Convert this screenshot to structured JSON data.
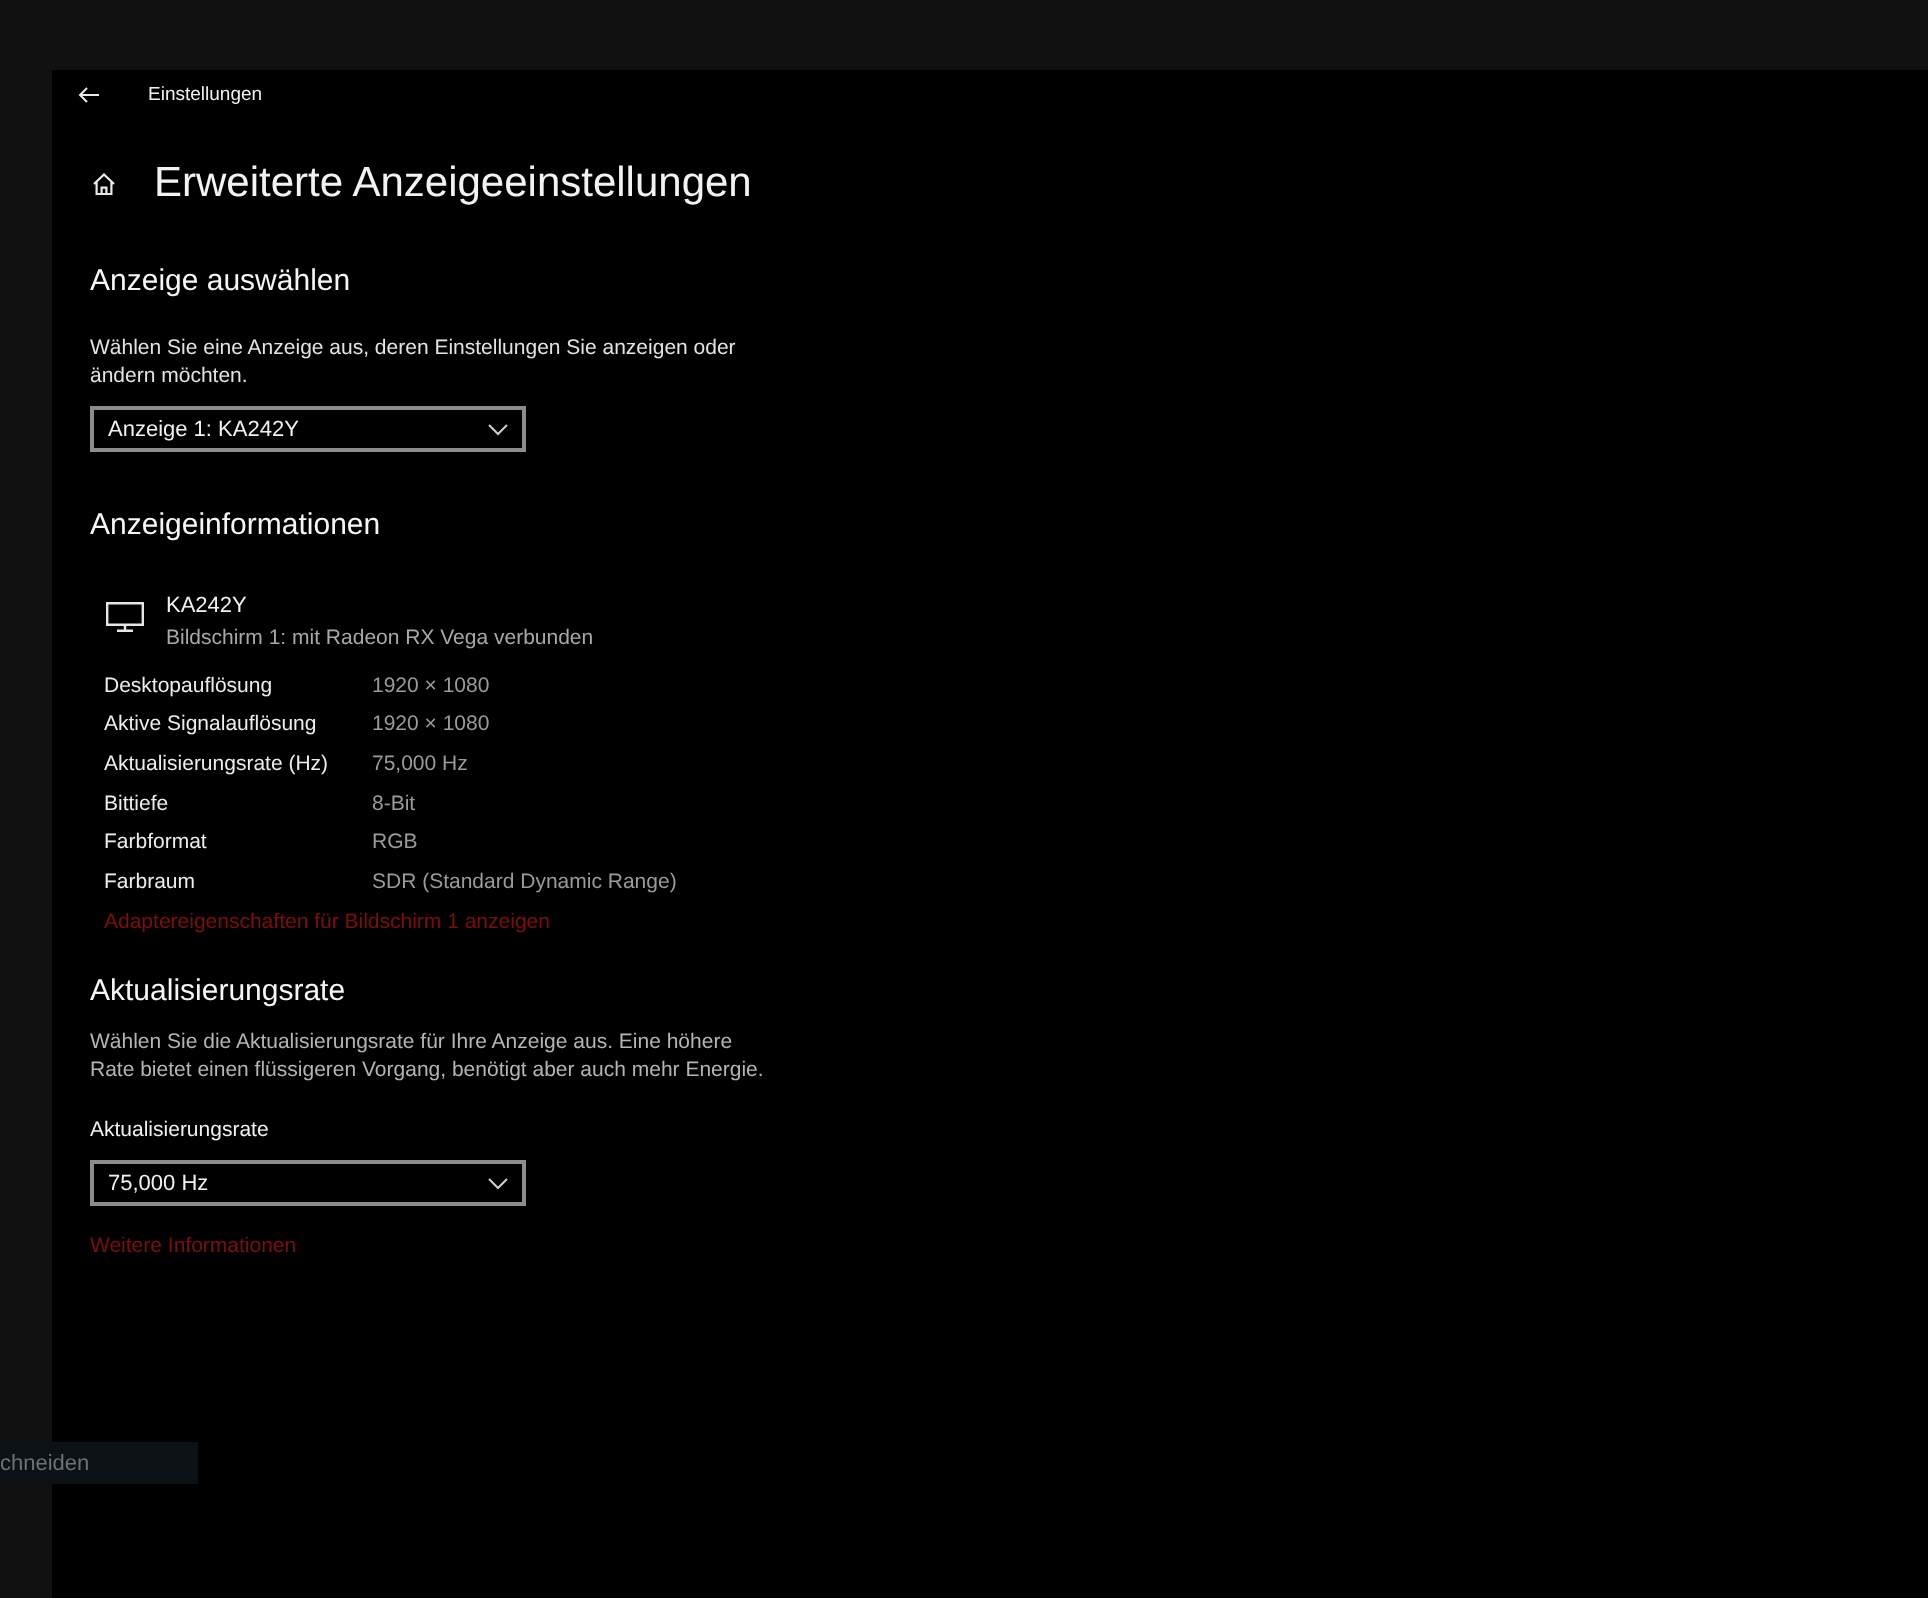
{
  "window": {
    "title": "Einstellungen"
  },
  "page": {
    "title": "Erweiterte Anzeigeeinstellungen"
  },
  "select_display": {
    "heading": "Anzeige auswählen",
    "description": "Wählen Sie eine Anzeige aus, deren Einstellungen Sie anzeigen oder ändern möchten.",
    "dropdown": {
      "value": "Anzeige 1: KA242Y"
    }
  },
  "display_info": {
    "heading": "Anzeigeinformationen",
    "monitor": {
      "name": "KA242Y",
      "connection": "Bildschirm 1: mit Radeon RX Vega verbunden"
    },
    "rows": [
      {
        "label": "Desktopauflösung",
        "value": "1920 × 1080"
      },
      {
        "label": "Aktive Signalauflösung",
        "value": "1920 × 1080"
      },
      {
        "label": "Aktualisierungsrate (Hz)",
        "value": "75,000 Hz"
      },
      {
        "label": "Bittiefe",
        "value": "8-Bit"
      },
      {
        "label": "Farbformat",
        "value": "RGB"
      },
      {
        "label": "Farbraum",
        "value": "SDR (Standard Dynamic Range)"
      }
    ],
    "link": "Adaptereigenschaften für Bildschirm 1 anzeigen"
  },
  "refresh_rate": {
    "heading": "Aktualisierungsrate",
    "description": "Wählen Sie die Aktualisierungsrate für Ihre Anzeige aus. Eine höhere Rate bietet einen flüssigeren Vorgang, benötigt aber auch mehr Energie.",
    "field_label": "Aktualisierungsrate",
    "dropdown": {
      "value": "75,000 Hz"
    },
    "link": "Weitere Informationen"
  },
  "background_tooltip": {
    "text": "chneiden"
  }
}
